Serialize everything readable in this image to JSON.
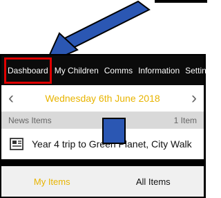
{
  "tabs": [
    "Dashboard",
    "My Children",
    "Comms",
    "Information",
    "Settings"
  ],
  "date": "Wednesday 6th June 2018",
  "news": {
    "header": "News Items",
    "count": "1 Item",
    "item": "Year 4 trip to Green Planet, City Walk"
  },
  "bottom_tabs": {
    "my": "My Items",
    "all": "All Items"
  },
  "colors": {
    "accent": "#e8b400",
    "highlight": "#e00000",
    "arrow": "#2b57b3"
  }
}
